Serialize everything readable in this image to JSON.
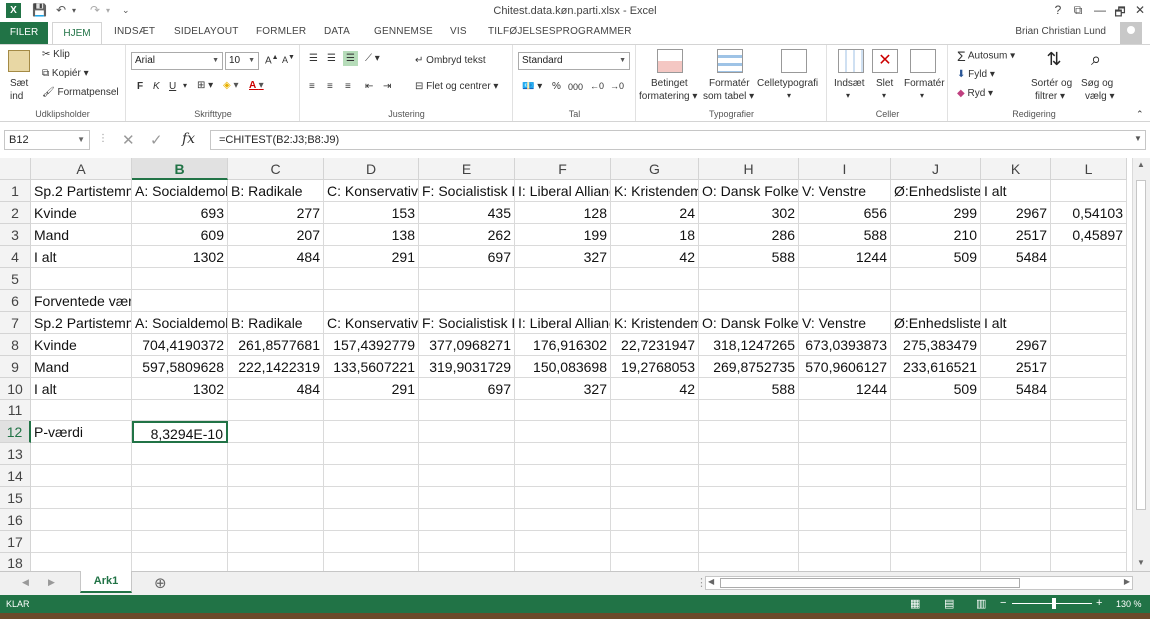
{
  "titlebar": {
    "title": "Chitest.data.køn.parti.xlsx - Excel",
    "help": "?",
    "minimize": "—",
    "restore": "🗗",
    "close": "✕"
  },
  "tabs": {
    "file": "FILER",
    "active": "HJEM",
    "items": [
      "INDSÆT",
      "SIDELAYOUT",
      "FORMLER",
      "DATA",
      "GENNEMSE",
      "VIS",
      "TILFØJELSESPROGRAMMER"
    ],
    "user": "Brian Christian Lund"
  },
  "ribbon": {
    "clipboard": {
      "paste": "Sæt",
      "paste2": "ind",
      "cut": "Klip",
      "copy": "Kopiér",
      "painter": "Formatpensel",
      "label": "Udklipsholder"
    },
    "font": {
      "name": "Arial",
      "size": "10",
      "bold": "F",
      "italic": "K",
      "underline": "U",
      "label": "Skrifttype"
    },
    "align": {
      "wrap": "Ombryd tekst",
      "merge": "Flet og centrer",
      "label": "Justering"
    },
    "number": {
      "format": "Standard",
      "percent": "%",
      "comma": "000",
      "label": "Tal"
    },
    "styles": {
      "cond1": "Betinget",
      "cond2": "formatering",
      "table1": "Formatér",
      "table2": "som tabel",
      "cell": "Celletypografi",
      "label": "Typografier"
    },
    "cells": {
      "insert": "Indsæt",
      "delete": "Slet",
      "format": "Formatér",
      "label": "Celler"
    },
    "editing": {
      "autosum": "Autosum",
      "fill": "Fyld",
      "clear": "Ryd",
      "sort1": "Sortér og",
      "sort2": "filtrer",
      "find1": "Søg og",
      "find2": "vælg",
      "label": "Redigering"
    }
  },
  "formula_bar": {
    "name_box": "B12",
    "fx": "fx",
    "formula": "=CHITEST(B2:J3;B8:J9)"
  },
  "grid": {
    "columns": [
      "A",
      "B",
      "C",
      "D",
      "E",
      "F",
      "G",
      "H",
      "I",
      "J",
      "K",
      "L"
    ],
    "rows": [
      "1",
      "2",
      "3",
      "4",
      "5",
      "6",
      "7",
      "8",
      "9",
      "10",
      "11",
      "12",
      "13",
      "14",
      "15",
      "16",
      "17",
      "18"
    ],
    "cells": [
      [
        "Sp.2 Partistemm",
        "A: Socialdemok",
        "B: Radikale",
        "C: Konservative",
        "F: Socialistisk F",
        "I: Liberal Allianc",
        "K: Kristendem",
        "O: Dansk Folkep",
        "V: Venstre",
        "Ø:Enhedsliste",
        "I alt",
        ""
      ],
      [
        "Kvinde",
        "693",
        "277",
        "153",
        "435",
        "128",
        "24",
        "302",
        "656",
        "299",
        "2967",
        "0,54103"
      ],
      [
        "Mand",
        "609",
        "207",
        "138",
        "262",
        "199",
        "18",
        "286",
        "588",
        "210",
        "2517",
        "0,45897"
      ],
      [
        "I alt",
        "1302",
        "484",
        "291",
        "697",
        "327",
        "42",
        "588",
        "1244",
        "509",
        "5484",
        ""
      ],
      [
        "",
        "",
        "",
        "",
        "",
        "",
        "",
        "",
        "",
        "",
        "",
        ""
      ],
      [
        "Forventede værdier",
        "",
        "",
        "",
        "",
        "",
        "",
        "",
        "",
        "",
        "",
        ""
      ],
      [
        "Sp.2 Partistemm",
        "A: Socialdemok",
        "B: Radikale",
        "C: Konservative",
        "F: Socialistisk F",
        "I: Liberal Allianc",
        "K: Kristendem",
        "O: Dansk Folkep",
        "V: Venstre",
        "Ø:Enhedsliste",
        "I alt",
        ""
      ],
      [
        "Kvinde",
        "704,4190372",
        "261,8577681",
        "157,4392779",
        "377,0968271",
        "176,916302",
        "22,7231947",
        "318,1247265",
        "673,0393873",
        "275,383479",
        "2967",
        ""
      ],
      [
        "Mand",
        "597,5809628",
        "222,1422319",
        "133,5607221",
        "319,9031729",
        "150,083698",
        "19,2768053",
        "269,8752735",
        "570,9606127",
        "233,616521",
        "2517",
        ""
      ],
      [
        "I alt",
        "1302",
        "484",
        "291",
        "697",
        "327",
        "42",
        "588",
        "1244",
        "509",
        "5484",
        ""
      ],
      [
        "",
        "",
        "",
        "",
        "",
        "",
        "",
        "",
        "",
        "",
        "",
        ""
      ],
      [
        "P-værdi",
        "8,3294E-10",
        "",
        "",
        "",
        "",
        "",
        "",
        "",
        "",
        "",
        ""
      ]
    ]
  },
  "sheets": {
    "active": "Ark1",
    "add": "⊕"
  },
  "status": {
    "mode": "KLAR",
    "zoom": "130 %"
  }
}
